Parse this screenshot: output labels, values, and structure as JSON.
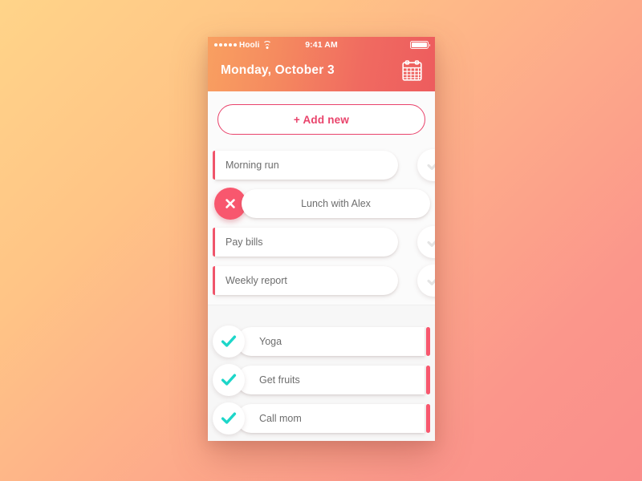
{
  "colors": {
    "accent_red": "#F8576E",
    "accent_crimson": "#E9436B",
    "check_teal": "#1DD6C9",
    "check_grey": "#E2E2E2",
    "bg_gradient_from": "#FFD489",
    "bg_gradient_to": "#FA8E8B",
    "header_gradient_from": "#F9A061",
    "header_gradient_to": "#ED5C5E",
    "text_grey": "#6D6D6D"
  },
  "statusbar": {
    "carrier": "Hooli",
    "time": "9:41 AM",
    "signal_icon": "signal-dots-icon",
    "wifi_icon": "wifi-icon",
    "battery_icon": "battery-full-icon"
  },
  "header": {
    "title": "Monday, October 3",
    "calendar_icon": "calendar-icon"
  },
  "add_button": {
    "label": "+ Add new"
  },
  "sections": {
    "pending": {
      "tasks": [
        {
          "label": "Morning run",
          "state": "pending",
          "action_icon": "check-circle-icon"
        },
        {
          "label": "Lunch with Alex",
          "state": "swiped",
          "action_icon": "delete-x-icon"
        },
        {
          "label": "Pay bills",
          "state": "pending",
          "action_icon": "check-circle-icon"
        },
        {
          "label": "Weekly report",
          "state": "pending",
          "action_icon": "check-circle-icon"
        }
      ]
    },
    "done": {
      "tasks": [
        {
          "label": "Yoga",
          "state": "done",
          "action_icon": "check-done-icon"
        },
        {
          "label": "Get fruits",
          "state": "done",
          "action_icon": "check-done-icon"
        },
        {
          "label": "Call mom",
          "state": "done",
          "action_icon": "check-done-icon"
        }
      ]
    }
  }
}
